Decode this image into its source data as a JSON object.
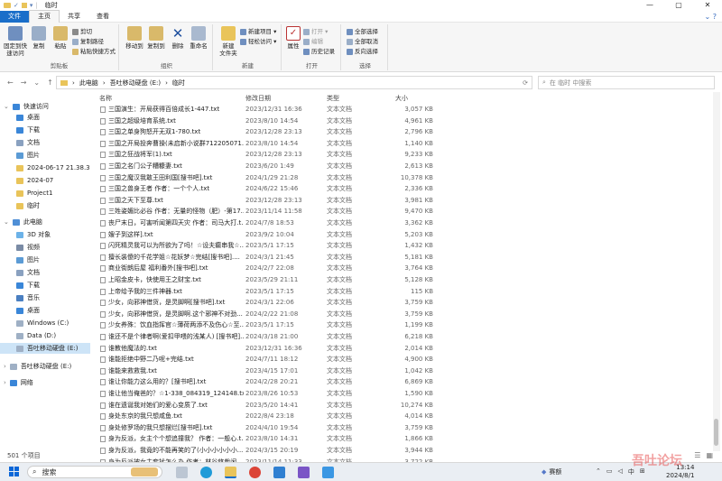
{
  "window": {
    "title": "临时",
    "controls": [
      "—",
      "▢",
      "✕"
    ]
  },
  "ribbon_tabs": [
    "文件",
    "主页",
    "共享",
    "查看"
  ],
  "ribbon": {
    "clipboard": {
      "label": "剪贴板",
      "pin": "固定到快\n速访问",
      "copy": "复制",
      "paste": "粘贴",
      "cut": "剪切",
      "copy_path": "复制路径",
      "paste_shortcut": "粘贴快捷方式"
    },
    "organize": {
      "label": "组织",
      "move_to": "移动到",
      "copy_to": "复制到",
      "delete": "删除",
      "rename": "重命名"
    },
    "new": {
      "label": "新建",
      "new_folder": "新建\n文件夹",
      "new_item": "新建项目 ▾",
      "easy_access": "轻松访问 ▾"
    },
    "open": {
      "label": "打开",
      "properties": "属性",
      "open": "打开 ▾",
      "edit": "编辑",
      "history": "历史记录"
    },
    "select": {
      "label": "选择",
      "select_all": "全部选择",
      "select_none": "全部取消",
      "invert": "反向选择"
    }
  },
  "address": {
    "path": [
      "此电脑",
      "吾吐移动硬盘 (E:)",
      "临时"
    ],
    "search_placeholder": "在 临时 中搜索"
  },
  "columns": {
    "name": "名称",
    "date": "修改日期",
    "type": "类型",
    "size": "大小"
  },
  "nav": {
    "quick_access": "快速访问",
    "items": [
      "桌面",
      "下载",
      "文档",
      "图片",
      "2024-06-17 21.38.38",
      "2024-07",
      "Project1",
      "临时"
    ],
    "this_pc": "此电脑",
    "pc_items": [
      "3D 对象",
      "视频",
      "图片",
      "文档",
      "下载",
      "音乐",
      "桌面",
      "Windows (C:)",
      "Data (D:)",
      "吾吐移动硬盘 (E:)"
    ],
    "drive": "吾吐移动硬盘 (E:)",
    "network": "网络"
  },
  "files": [
    {
      "name": "三国演生：开局获得百倍成长1-447.txt",
      "date": "2023/12/31 16:36",
      "type": "文本文档",
      "size": "3,057 KB"
    },
    {
      "name": "三国之超级培育系统.txt",
      "date": "2023/8/10 14:54",
      "type": "文本文档",
      "size": "4,961 KB"
    },
    {
      "name": "三国之单身狗怒开无双1-780.txt",
      "date": "2023/12/28 23:13",
      "type": "文本文档",
      "size": "2,796 KB"
    },
    {
      "name": "三国之开局投奔曹操(未启新小说群712205071...",
      "date": "2023/8/10 14:54",
      "type": "文本文档",
      "size": "1,140 KB"
    },
    {
      "name": "三国之狂战将军(1).txt",
      "date": "2023/12/28 23:13",
      "type": "文本文档",
      "size": "9,233 KB"
    },
    {
      "name": "三国之名门公子糟糠妻.txt",
      "date": "2023/6/20 1:49",
      "type": "文本文档",
      "size": "2,613 KB"
    },
    {
      "name": "三国之魔汉我敢王田利国[搜书吧].txt",
      "date": "2024/1/29 21:28",
      "type": "文本文档",
      "size": "10,378 KB"
    },
    {
      "name": "三国之兽身王者 作者：一个个人.txt",
      "date": "2024/6/22 15:46",
      "type": "文本文档",
      "size": "2,336 KB"
    },
    {
      "name": "三国之天下至尊.txt",
      "date": "2023/12/28 23:13",
      "type": "文本文档",
      "size": "3,981 KB"
    },
    {
      "name": "三姓姿媚比必谷 作者：无量的怪物（肥）-第17...",
      "date": "2023/11/14 11:58",
      "type": "文本文档",
      "size": "9,470 KB"
    },
    {
      "name": "丧尸末日，可害听闻第四天灾 作者：司马大打.t...",
      "date": "2024/7/8 18:53",
      "type": "文本文档",
      "size": "3,362 KB"
    },
    {
      "name": "嫂子到这样].txt",
      "date": "2023/9/2 10:04",
      "type": "文本文档",
      "size": "5,203 KB"
    },
    {
      "name": "闪死精灵我可以为所欲为了吗！☆设夫癫串我☆...",
      "date": "2023/5/1 17:15",
      "type": "文本文档",
      "size": "1,432 KB"
    },
    {
      "name": "擅长装傻的千花学姐☆花妖梦☆完结[搜书吧]....",
      "date": "2024/3/1 21:45",
      "type": "文本文档",
      "size": "5,181 KB"
    },
    {
      "name": "商业街朗后屋 福利番外[搜书吧].txt",
      "date": "2024/2/7 22:08",
      "type": "文本文档",
      "size": "3,764 KB"
    },
    {
      "name": "上昭金皮卡，快使用王之财宝.txt",
      "date": "2023/5/29 21:11",
      "type": "文本文档",
      "size": "5,128 KB"
    },
    {
      "name": "上帝给予我的三件神器.txt",
      "date": "2023/5/1 17:15",
      "type": "文本文档",
      "size": "115 KB"
    },
    {
      "name": "少女，向邪神借货，是灵脚啊[搜书吧].txt",
      "date": "2024/3/1 22:06",
      "type": "文本文档",
      "size": "3,759 KB"
    },
    {
      "name": "少女，向邪神借货，是灵脚啊.这个邪神不对劲...",
      "date": "2024/2/22 21:08",
      "type": "文本文档",
      "size": "3,759 KB"
    },
    {
      "name": "少女养殊：饮血指挥官☆薄荷两添不及伤心☆至...",
      "date": "2023/5/1 17:15",
      "type": "文本文档",
      "size": "1,199 KB"
    },
    {
      "name": "谁还不是个律者啊(爱扣甲喂的浅某人) [搜书吧]....",
      "date": "2024/3/18 21:00",
      "type": "文本文档",
      "size": "6,218 KB"
    },
    {
      "name": "谁教他魔法的.txt",
      "date": "2023/12/31 16:36",
      "type": "文本文档",
      "size": "2,014 KB"
    },
    {
      "name": "谁能拒绝中野二乃呢+完结.txt",
      "date": "2024/7/11 18:12",
      "type": "文本文档",
      "size": "4,900 KB"
    },
    {
      "name": "谁能来救救我.txt",
      "date": "2023/4/15 17:01",
      "type": "文本文档",
      "size": "1,042 KB"
    },
    {
      "name": "谁让你能力这么用的？[搜书吧].txt",
      "date": "2024/2/28 20:21",
      "type": "文本文档",
      "size": "6,869 KB"
    },
    {
      "name": "谁让他当俺爸的？☆1-338_084319_124148.txt",
      "date": "2023/8/26 10:53",
      "type": "文本文档",
      "size": "1,590 KB"
    },
    {
      "name": "谁在遗诞我对她们的爱心变质了.txt",
      "date": "2023/5/20 14:41",
      "type": "文本文档",
      "size": "10,274 KB"
    },
    {
      "name": "身处东京的我只想咸鱼.txt",
      "date": "2022/8/4 23:18",
      "type": "文本文档",
      "size": "4,014 KB"
    },
    {
      "name": "身处修罗场的我只想摆烂[搜书吧].txt",
      "date": "2024/4/10 19:54",
      "type": "文本文档",
      "size": "3,759 KB"
    },
    {
      "name": "身为反派，女主个个想追撞我？ 作者：一般心.t...",
      "date": "2023/8/10 14:31",
      "type": "文本文档",
      "size": "1,866 KB"
    },
    {
      "name": "身为反派，我竟的不能再笑的了(小小小小小小...",
      "date": "2024/3/15 20:19",
      "type": "文本文档",
      "size": "3,944 KB"
    },
    {
      "name": "身为反派被女主套扰怎么办 作者：林谷悠哉闲...",
      "date": "2023/11/14 11:33",
      "type": "文本文档",
      "size": "3,722 KB"
    }
  ],
  "status": {
    "count": "501 个项目"
  },
  "taskbar": {
    "search": "搜索",
    "weather": "赛额",
    "ime": "中",
    "time": "13:14",
    "date": "2024/8/1"
  },
  "watermark": "吾吐论坛"
}
